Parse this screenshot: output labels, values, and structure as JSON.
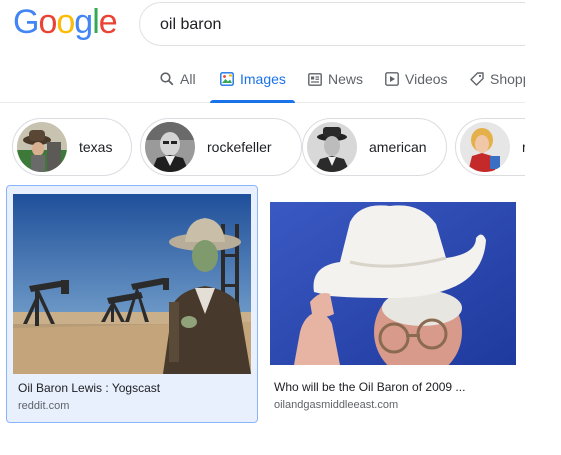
{
  "logo": {
    "letters": [
      "G",
      "o",
      "o",
      "g",
      "l",
      "e"
    ],
    "colors": [
      "#4285f4",
      "#ea4335",
      "#fbbc05",
      "#4285f4",
      "#34a853",
      "#ea4335"
    ]
  },
  "search": {
    "query": "oil baron"
  },
  "tabs": [
    {
      "label": "All",
      "icon": "search-icon",
      "active": false
    },
    {
      "label": "Images",
      "icon": "image-icon",
      "active": true
    },
    {
      "label": "News",
      "icon": "newspaper-icon",
      "active": false
    },
    {
      "label": "Videos",
      "icon": "play-icon",
      "active": false
    },
    {
      "label": "Shopp",
      "icon": "tag-icon",
      "active": false
    }
  ],
  "chips": [
    {
      "label": "texas"
    },
    {
      "label": "rockefeller"
    },
    {
      "label": "american"
    },
    {
      "label": "r"
    }
  ],
  "results": [
    {
      "title": "Oil Baron Lewis : Yogscast",
      "source": "reddit.com",
      "selected": true
    },
    {
      "title": "Who will be the Oil Baron of 2009 ...",
      "source": "oilandgasmiddleeast.com",
      "selected": false
    }
  ],
  "colors": {
    "accent": "#1a73e8",
    "selected_bg": "#e8f0fe",
    "selected_border": "#8ab4f8"
  }
}
